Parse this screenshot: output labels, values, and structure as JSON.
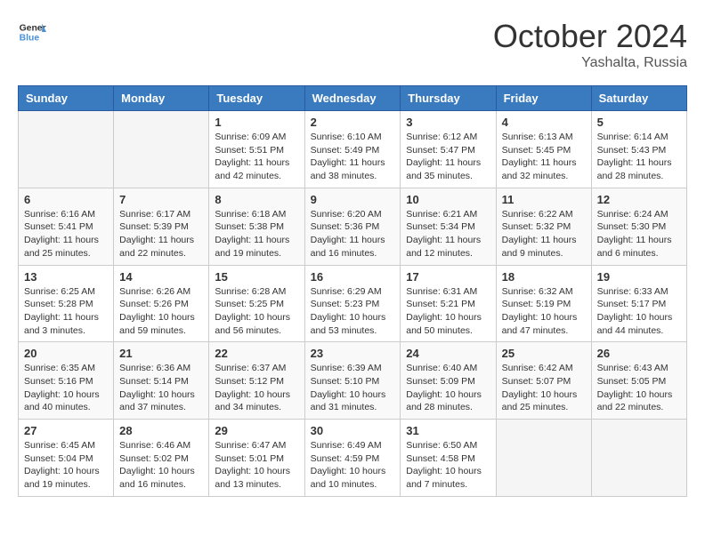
{
  "logo": {
    "line1": "General",
    "line2": "Blue"
  },
  "title": "October 2024",
  "location": "Yashalta, Russia",
  "days_of_week": [
    "Sunday",
    "Monday",
    "Tuesday",
    "Wednesday",
    "Thursday",
    "Friday",
    "Saturday"
  ],
  "weeks": [
    [
      {
        "day": "",
        "info": ""
      },
      {
        "day": "",
        "info": ""
      },
      {
        "day": "1",
        "info": "Sunrise: 6:09 AM\nSunset: 5:51 PM\nDaylight: 11 hours and 42 minutes."
      },
      {
        "day": "2",
        "info": "Sunrise: 6:10 AM\nSunset: 5:49 PM\nDaylight: 11 hours and 38 minutes."
      },
      {
        "day": "3",
        "info": "Sunrise: 6:12 AM\nSunset: 5:47 PM\nDaylight: 11 hours and 35 minutes."
      },
      {
        "day": "4",
        "info": "Sunrise: 6:13 AM\nSunset: 5:45 PM\nDaylight: 11 hours and 32 minutes."
      },
      {
        "day": "5",
        "info": "Sunrise: 6:14 AM\nSunset: 5:43 PM\nDaylight: 11 hours and 28 minutes."
      }
    ],
    [
      {
        "day": "6",
        "info": "Sunrise: 6:16 AM\nSunset: 5:41 PM\nDaylight: 11 hours and 25 minutes."
      },
      {
        "day": "7",
        "info": "Sunrise: 6:17 AM\nSunset: 5:39 PM\nDaylight: 11 hours and 22 minutes."
      },
      {
        "day": "8",
        "info": "Sunrise: 6:18 AM\nSunset: 5:38 PM\nDaylight: 11 hours and 19 minutes."
      },
      {
        "day": "9",
        "info": "Sunrise: 6:20 AM\nSunset: 5:36 PM\nDaylight: 11 hours and 16 minutes."
      },
      {
        "day": "10",
        "info": "Sunrise: 6:21 AM\nSunset: 5:34 PM\nDaylight: 11 hours and 12 minutes."
      },
      {
        "day": "11",
        "info": "Sunrise: 6:22 AM\nSunset: 5:32 PM\nDaylight: 11 hours and 9 minutes."
      },
      {
        "day": "12",
        "info": "Sunrise: 6:24 AM\nSunset: 5:30 PM\nDaylight: 11 hours and 6 minutes."
      }
    ],
    [
      {
        "day": "13",
        "info": "Sunrise: 6:25 AM\nSunset: 5:28 PM\nDaylight: 11 hours and 3 minutes."
      },
      {
        "day": "14",
        "info": "Sunrise: 6:26 AM\nSunset: 5:26 PM\nDaylight: 10 hours and 59 minutes."
      },
      {
        "day": "15",
        "info": "Sunrise: 6:28 AM\nSunset: 5:25 PM\nDaylight: 10 hours and 56 minutes."
      },
      {
        "day": "16",
        "info": "Sunrise: 6:29 AM\nSunset: 5:23 PM\nDaylight: 10 hours and 53 minutes."
      },
      {
        "day": "17",
        "info": "Sunrise: 6:31 AM\nSunset: 5:21 PM\nDaylight: 10 hours and 50 minutes."
      },
      {
        "day": "18",
        "info": "Sunrise: 6:32 AM\nSunset: 5:19 PM\nDaylight: 10 hours and 47 minutes."
      },
      {
        "day": "19",
        "info": "Sunrise: 6:33 AM\nSunset: 5:17 PM\nDaylight: 10 hours and 44 minutes."
      }
    ],
    [
      {
        "day": "20",
        "info": "Sunrise: 6:35 AM\nSunset: 5:16 PM\nDaylight: 10 hours and 40 minutes."
      },
      {
        "day": "21",
        "info": "Sunrise: 6:36 AM\nSunset: 5:14 PM\nDaylight: 10 hours and 37 minutes."
      },
      {
        "day": "22",
        "info": "Sunrise: 6:37 AM\nSunset: 5:12 PM\nDaylight: 10 hours and 34 minutes."
      },
      {
        "day": "23",
        "info": "Sunrise: 6:39 AM\nSunset: 5:10 PM\nDaylight: 10 hours and 31 minutes."
      },
      {
        "day": "24",
        "info": "Sunrise: 6:40 AM\nSunset: 5:09 PM\nDaylight: 10 hours and 28 minutes."
      },
      {
        "day": "25",
        "info": "Sunrise: 6:42 AM\nSunset: 5:07 PM\nDaylight: 10 hours and 25 minutes."
      },
      {
        "day": "26",
        "info": "Sunrise: 6:43 AM\nSunset: 5:05 PM\nDaylight: 10 hours and 22 minutes."
      }
    ],
    [
      {
        "day": "27",
        "info": "Sunrise: 6:45 AM\nSunset: 5:04 PM\nDaylight: 10 hours and 19 minutes."
      },
      {
        "day": "28",
        "info": "Sunrise: 6:46 AM\nSunset: 5:02 PM\nDaylight: 10 hours and 16 minutes."
      },
      {
        "day": "29",
        "info": "Sunrise: 6:47 AM\nSunset: 5:01 PM\nDaylight: 10 hours and 13 minutes."
      },
      {
        "day": "30",
        "info": "Sunrise: 6:49 AM\nSunset: 4:59 PM\nDaylight: 10 hours and 10 minutes."
      },
      {
        "day": "31",
        "info": "Sunrise: 6:50 AM\nSunset: 4:58 PM\nDaylight: 10 hours and 7 minutes."
      },
      {
        "day": "",
        "info": ""
      },
      {
        "day": "",
        "info": ""
      }
    ]
  ]
}
